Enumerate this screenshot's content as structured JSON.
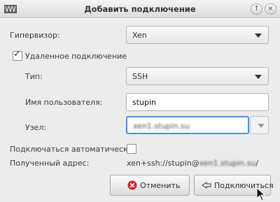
{
  "window": {
    "title": "Добавить подключение",
    "buttons": [
      "↑",
      "×"
    ]
  },
  "form": {
    "hypervisor_label": "Гипервизор:",
    "hypervisor_value": "Xen",
    "remote_label": "Удаленное подключение",
    "remote_checked": true,
    "type_label": "Тип:",
    "type_value": "SSH",
    "username_label": "Имя пользователя:",
    "username_value": "stupin",
    "host_label": "Узел:",
    "host_value": "xen1.stupin.su",
    "autoconnect_label": "Подключаться автоматически:",
    "autoconnect_checked": false,
    "address_label": "Полученный адрес:",
    "address_value_prefix": "xen+ssh://stupin@",
    "address_value_host": "xen1.stupin.su",
    "address_value_suffix": "/"
  },
  "actions": {
    "cancel_label": "Отменить",
    "connect_label": "Подключиться"
  },
  "colors": {
    "focus": "#4a90d9",
    "cancel_icon": "#c8262c"
  }
}
